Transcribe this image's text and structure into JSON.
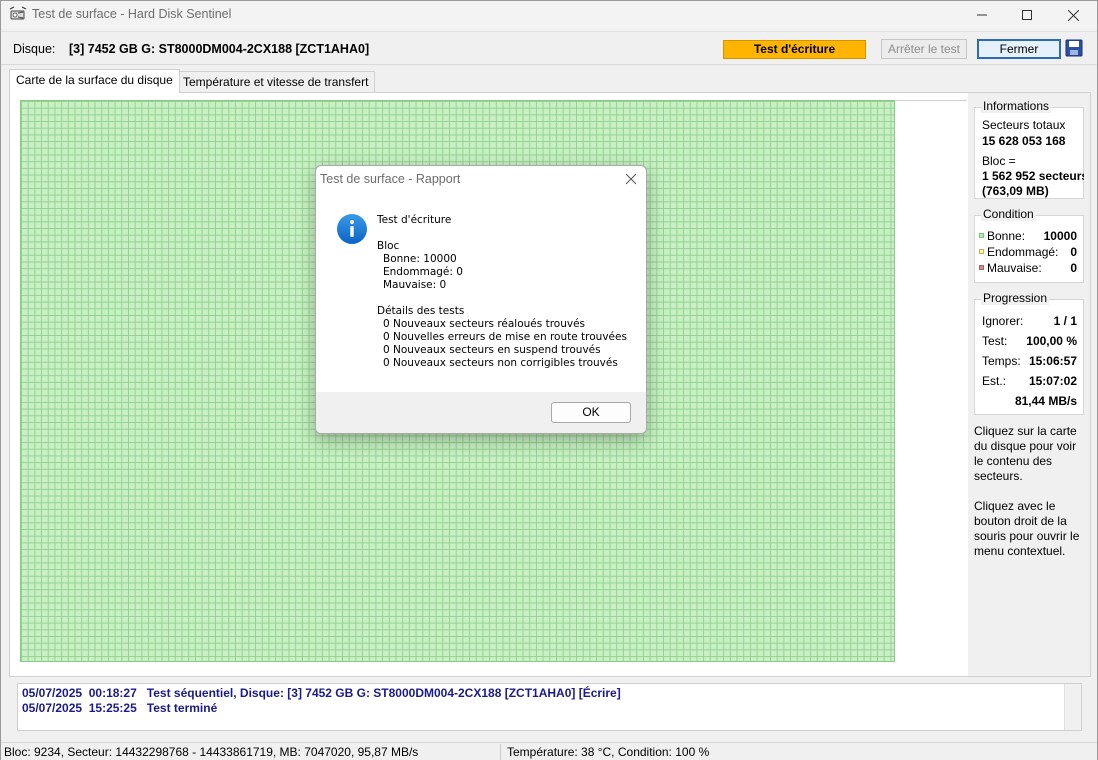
{
  "window": {
    "title": "Test de surface - Hard Disk Sentinel"
  },
  "diskbar": {
    "label": "Disque:",
    "value": "[3] 7452 GB G: ST8000DM004-2CX188 [ZCT1AHA0]",
    "test_badge": "Test d'écriture",
    "stop_button": "Arrêter le test",
    "close_button": "Fermer"
  },
  "tabs": [
    {
      "label": "Carte de la surface du disque"
    },
    {
      "label": "Température et vitesse de transfert"
    }
  ],
  "colors": {
    "good": "#c8f0c4",
    "damaged": "#fff2b0",
    "bad": "#d08c8c",
    "badge": "#ffb400",
    "log_text": "#1a1a8c"
  },
  "info": {
    "title": "Informations",
    "total_sectors_label": "Secteurs totaux",
    "total_sectors_value": "15 628 053 168",
    "block_label": "Bloc =",
    "block_value": "1 562 952 secteurs",
    "block_size": "(763,09 MB)"
  },
  "condition": {
    "title": "Condition",
    "good_label": "Bonne:",
    "good_value": "10000",
    "damaged_label": "Endommagé:",
    "damaged_value": "0",
    "bad_label": "Mauvaise:",
    "bad_value": "0"
  },
  "progress": {
    "title": "Progression",
    "ignore_label": "Ignorer:",
    "ignore_value": "1 / 1",
    "test_label": "Test:",
    "test_value": "100,00 %",
    "time_label": "Temps:",
    "time_value": "15:06:57",
    "est_label": "Est.:",
    "est_value": "15:07:02",
    "speed": "81,44 MB/s"
  },
  "hints": {
    "click": "Cliquez sur la carte du disque pour voir le contenu des secteurs.",
    "right_click": "Cliquez avec le bouton droit de la souris pour ouvrir le menu contextuel."
  },
  "log": [
    {
      "date": "05/07/2025",
      "time": "00:18:27",
      "text": "Test séquentiel, Disque: [3] 7452 GB G: ST8000DM004-2CX188 [ZCT1AHA0] [Écrire]"
    },
    {
      "date": "05/07/2025",
      "time": "15:25:25",
      "text": "Test terminé"
    }
  ],
  "status": {
    "left": "Bloc: 9234, Secteur: 14432298768 - 14433861719, MB: 7047020, 95,87 MB/s",
    "right": "Température: 38  °C,  Condition: 100 %"
  },
  "dialog": {
    "title": "Test de surface - Rapport",
    "heading": "Test d'écriture",
    "block_title": "Bloc",
    "good": "Bonne: 10000",
    "damaged": "Endommagé: 0",
    "bad": "Mauvaise: 0",
    "details_title": "Détails des tests",
    "detail_1": "0 Nouveaux secteurs réaloués trouvés",
    "detail_2": "0 Nouvelles erreurs de mise en route trouvées",
    "detail_3": "0 Nouveaux secteurs en suspend trouvés",
    "detail_4": "0 Nouveaux secteurs non corrigibles trouvés",
    "ok_button": "OK"
  }
}
